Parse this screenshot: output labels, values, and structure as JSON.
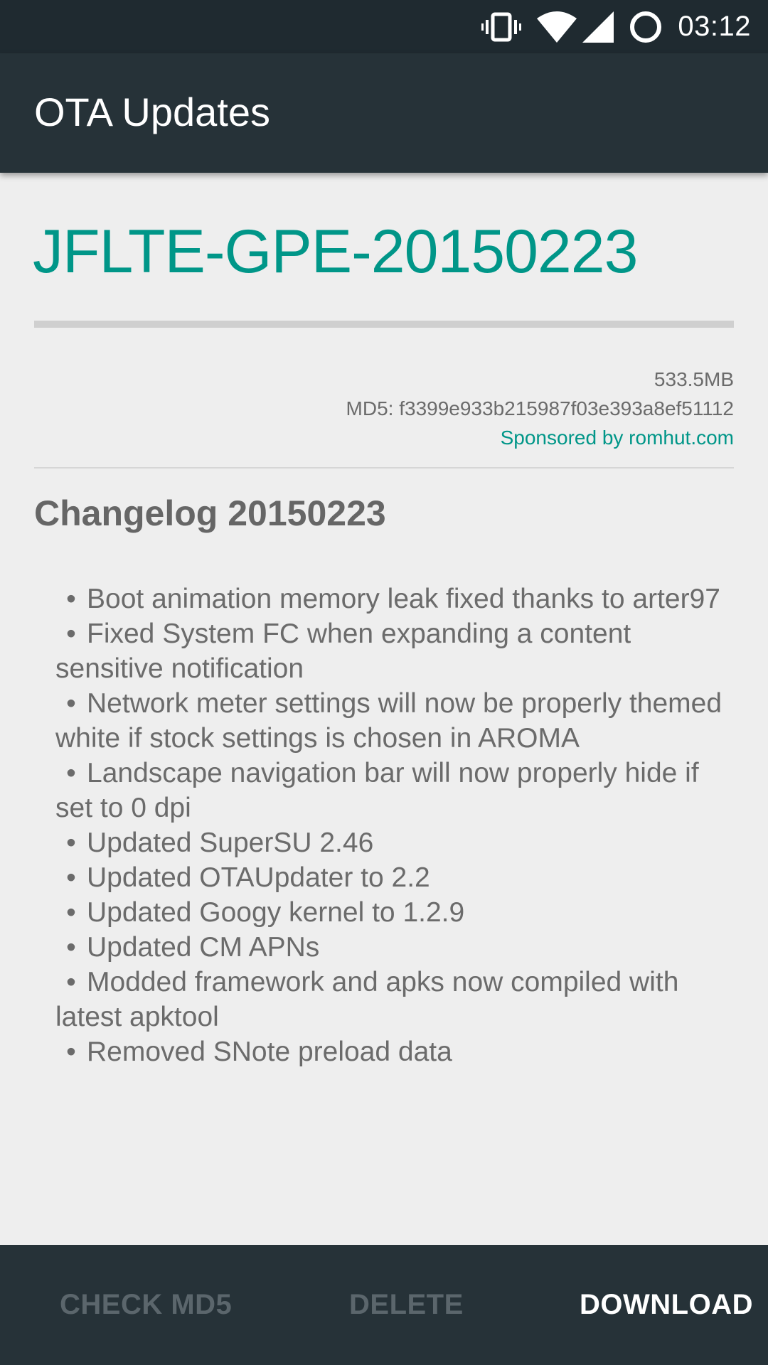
{
  "status_bar": {
    "time": "03:12",
    "icons": [
      "vibrate-icon",
      "wifi-icon",
      "cell-signal-icon",
      "circle-icon"
    ]
  },
  "app_bar": {
    "title": "OTA Updates"
  },
  "update": {
    "build_name": "JFLTE-GPE-20150223",
    "size": "533.5MB",
    "md5": "MD5: f3399e933b215987f03e393a8ef51112",
    "sponsor": "Sponsored by romhut.com"
  },
  "changelog": {
    "title": "Changelog 20150223",
    "items": [
      "Boot animation memory leak fixed thanks to arter97",
      "Fixed System FC when expanding a content sensitive notification",
      "Network meter settings will now be properly themed white if stock settings is chosen in AROMA",
      "Landscape navigation bar will now properly hide if set to 0 dpi",
      "Updated SuperSU 2.46",
      "Updated OTAUpdater to 2.2",
      "Updated Googy kernel to 1.2.9",
      "Updated CM APNs",
      "Modded framework and apks now compiled with latest apktool",
      "Removed SNote preload data"
    ]
  },
  "actions": {
    "check_md5": "CHECK MD5",
    "delete": "DELETE",
    "download": "DOWNLOAD"
  },
  "colors": {
    "accent": "#009688",
    "app_bar": "#263238",
    "status_bar": "#1f2a30",
    "background": "#eeeeee"
  }
}
